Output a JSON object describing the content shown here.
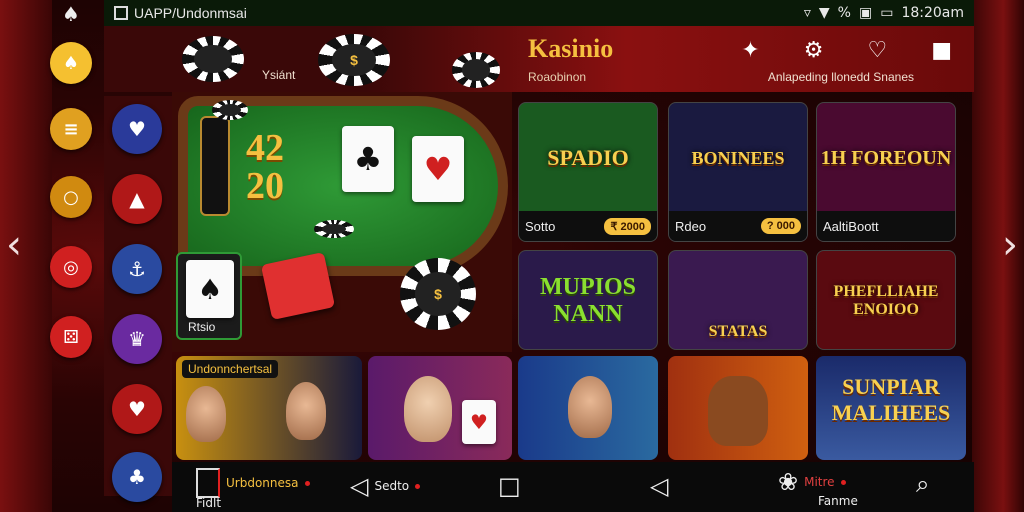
{
  "status_bar": {
    "app_title": "UAPP/Undonmsai",
    "app_icon": "app-grid-icon",
    "time": "18:20am",
    "signal": "%"
  },
  "header": {
    "brand": "Kasinio",
    "brand_sub": "Roaobinon",
    "subtitle": "Anlapeding llonedd Snanes",
    "icons": [
      "puzzle-icon",
      "gear-icon",
      "heart-icon",
      "bookmark-icon"
    ]
  },
  "table": {
    "label": "Ysiánt",
    "numbers": [
      "42",
      "20"
    ],
    "chip_top": "$",
    "chip_bottom": "$",
    "small_card_label": "Rtsio"
  },
  "sidebar_primary": [
    {
      "name": "promo",
      "color": "#f5c030",
      "glyph": "♠"
    },
    {
      "name": "stats",
      "color": "#e0a020",
      "glyph": "≡"
    },
    {
      "name": "coin",
      "color": "#d08a10",
      "glyph": "○"
    },
    {
      "name": "roulette",
      "color": "#d02020",
      "glyph": "◎"
    },
    {
      "name": "dice",
      "color": "#d02020",
      "glyph": "⚄"
    }
  ],
  "sidebar_secondary": [
    {
      "name": "badge",
      "color": "#2a3a9a",
      "glyph": "♥"
    },
    {
      "name": "gift",
      "color": "#b01818",
      "glyph": "▲"
    },
    {
      "name": "ship",
      "color": "#2a4aa0",
      "glyph": "⚓"
    },
    {
      "name": "crown",
      "color": "#6a2aa0",
      "glyph": "♛"
    },
    {
      "name": "heart",
      "color": "#b01818",
      "glyph": "♥"
    },
    {
      "name": "card",
      "color": "#2a4aa0",
      "glyph": "♣"
    }
  ],
  "games": [
    {
      "art": "SPADIO",
      "caption": "Sotto",
      "badge": "₹ 2000",
      "bg": "#1a5a20"
    },
    {
      "art": "BONINEES",
      "caption": "Rdeo",
      "badge": "? 000",
      "bg": "#1a1a40"
    },
    {
      "art": "1H FOREOUN",
      "caption": "AaltiBoott",
      "badge": "",
      "bg": "#4a0a30"
    },
    {
      "art": "MUPIOS NANN",
      "caption": "",
      "badge": "",
      "bg": "#2a1a4a"
    },
    {
      "art": "STATAS",
      "caption": "",
      "badge": "",
      "bg": "#3a1a50"
    },
    {
      "art": "PHEFLLIAHE ENOIOO",
      "caption": "",
      "badge": "",
      "bg": "#5a0a10"
    },
    {
      "art": "SUNPIAR MALIHEES",
      "caption": "",
      "badge": "",
      "bg": "#1a2a6a"
    }
  ],
  "promos": [
    {
      "tag": "Undonnchertsal"
    },
    {
      "tag": ""
    },
    {
      "tag": ""
    },
    {
      "tag": ""
    }
  ],
  "navbar": [
    {
      "icon": "frame-icon",
      "label": "Fidlt",
      "text": "Urbdonnesa"
    },
    {
      "icon": "back-icon",
      "label": "",
      "text": "Sedto"
    },
    {
      "icon": "home-icon",
      "label": "",
      "text": ""
    },
    {
      "icon": "back-icon",
      "label": "",
      "text": ""
    },
    {
      "icon": "cluster-icon",
      "label": "Fanme",
      "text": "Mitre"
    },
    {
      "icon": "profile-icon",
      "label": "",
      "text": ""
    }
  ]
}
